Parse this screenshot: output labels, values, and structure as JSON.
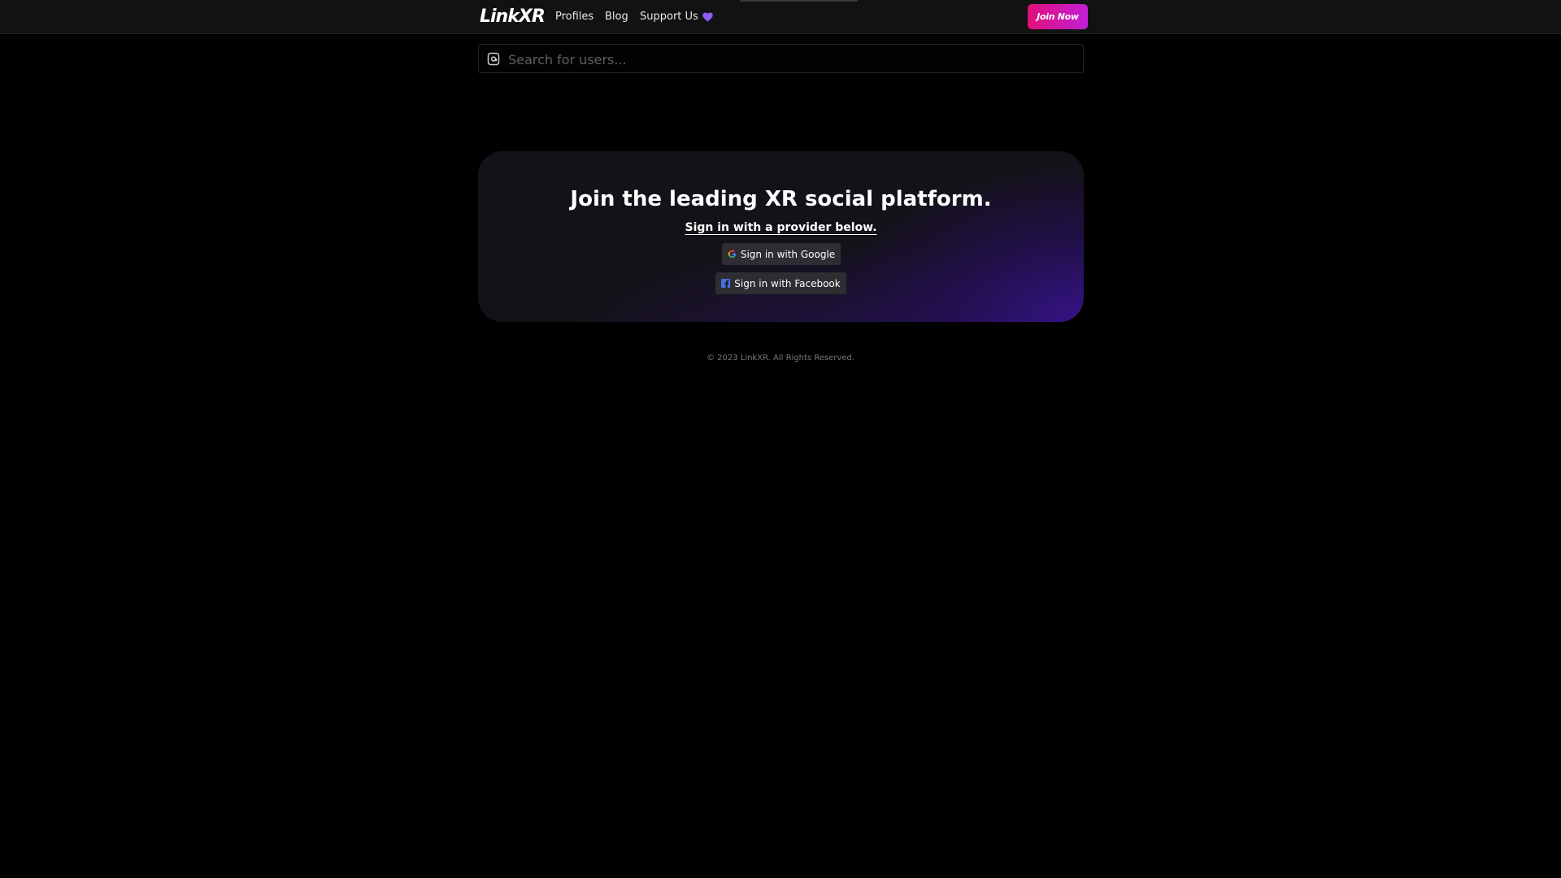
{
  "nav": {
    "logo": "LinkXR",
    "links": {
      "profiles": "Profiles",
      "blog": "Blog",
      "support": "Support Us"
    },
    "support_icon": "heart-icon",
    "join_label": "Join Now"
  },
  "search": {
    "placeholder": "Search for users...",
    "value": "",
    "icon": "at-sign-icon"
  },
  "hero": {
    "title": "Join the leading XR social platform.",
    "subtitle": "Sign in with a provider below.",
    "google_label": "Sign in with Google",
    "facebook_label": "Sign in with Facebook"
  },
  "footer": {
    "copyright": "© 2023 LinkXR. All Rights Reserved."
  },
  "colors": {
    "background": "#000000",
    "navbar": "#121212",
    "join_gradient_start": "#e0107a",
    "join_gradient_end": "#c21fd6",
    "heart": "#8b5cf6",
    "card_glow": "#37148c"
  }
}
